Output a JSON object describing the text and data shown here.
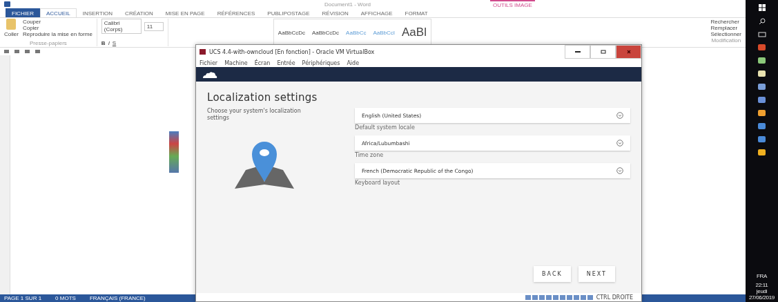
{
  "word": {
    "title": "Document1 - Word",
    "context_tab": "OUTILS IMAGE",
    "file_tab": "FICHIER",
    "tabs": [
      {
        "label": "ACCUEIL",
        "selected": true
      },
      {
        "label": "INSERTION",
        "selected": false
      },
      {
        "label": "CRÉATION",
        "selected": false
      },
      {
        "label": "MISE EN PAGE",
        "selected": false
      },
      {
        "label": "RÉFÉRENCES",
        "selected": false
      },
      {
        "label": "PUBLIPOSTAGE",
        "selected": false
      },
      {
        "label": "RÉVISION",
        "selected": false
      },
      {
        "label": "AFFICHAGE",
        "selected": false
      },
      {
        "label": "FORMAT",
        "selected": false
      }
    ],
    "clipboard": {
      "paste": "Coller",
      "items": [
        "Couper",
        "Copier",
        "Reproduire la mise en forme"
      ],
      "group": "Presse-papiers"
    },
    "font": {
      "name": "Calibri (Corps)",
      "size": "11",
      "format_buttons": [
        "B",
        "I",
        "S"
      ]
    },
    "styles": [
      "AaBbCcDc",
      "AaBbCcDc",
      "AaBbCc",
      "AaBbCcI",
      "AaBl"
    ],
    "editing": {
      "items": [
        "Rechercher",
        "Remplacer",
        "Sélectionner"
      ],
      "group": "Modification"
    },
    "status_bar": [
      "PAGE 1 SUR 1",
      "0 MOTS",
      "FRANÇAIS (FRANCE)"
    ]
  },
  "vbox": {
    "title": "UCS 4.4-with-owncloud [En fonction] - Oracle VM VirtualBox",
    "menu": [
      "Fichier",
      "Machine",
      "Écran",
      "Entrée",
      "Périphériques",
      "Aide"
    ],
    "heading": "Localization settings",
    "description": "Choose your system's localization settings",
    "fields": [
      {
        "value": "English (United States)",
        "helper": "Default system locale"
      },
      {
        "value": "Africa/Lubumbashi",
        "helper": "Time zone"
      },
      {
        "value": "French (Democratic Republic of the Congo)",
        "helper": "Keyboard layout"
      }
    ],
    "buttons": [
      "BACK",
      "NEXT"
    ],
    "host_key": "CTRL DROITE"
  },
  "taskbar": {
    "language": "FRA",
    "time": "22:11",
    "day": "jeudi",
    "date": "27/06/2019"
  }
}
